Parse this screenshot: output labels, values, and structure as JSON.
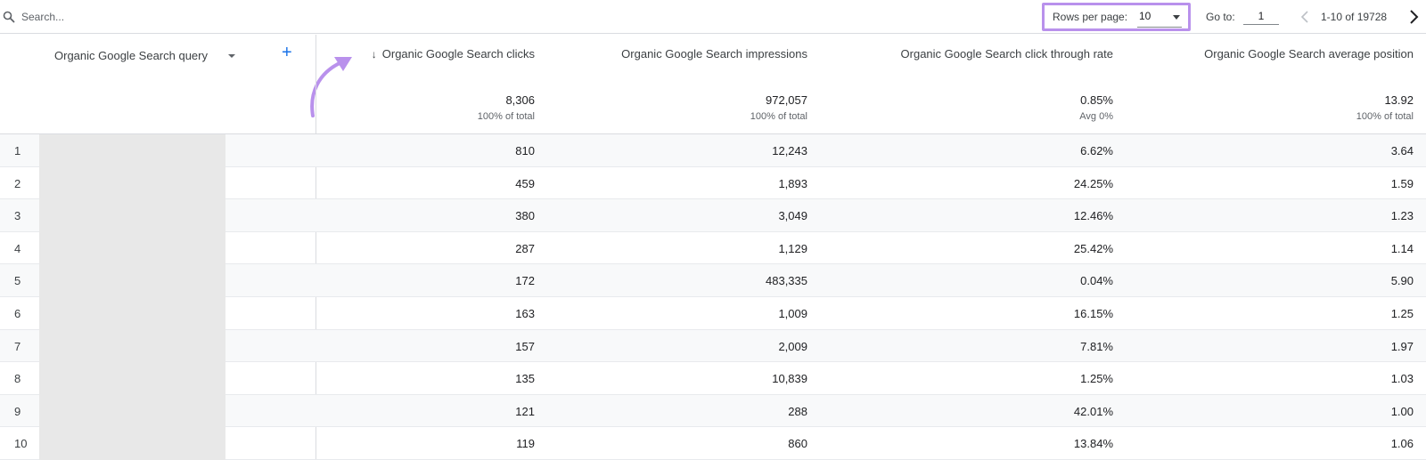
{
  "toolbar": {
    "search_placeholder": "Search...",
    "rows_per_page_label": "Rows per page:",
    "rows_per_page_value": "10",
    "goto_label": "Go to:",
    "goto_value": "1",
    "range_text": "1-10 of 19728"
  },
  "table": {
    "dimension_header": "Organic Google Search query",
    "columns": [
      {
        "label": "Organic Google Search clicks",
        "total": "8,306",
        "sub": "100% of total",
        "sorted": true
      },
      {
        "label": "Organic Google Search impressions",
        "total": "972,057",
        "sub": "100% of total"
      },
      {
        "label": "Organic Google Search click through rate",
        "total": "0.85%",
        "sub": "Avg 0%"
      },
      {
        "label": "Organic Google Search average position",
        "total": "13.92",
        "sub": "100% of total"
      }
    ],
    "rows": [
      {
        "index": "1",
        "clicks": "810",
        "impressions": "12,243",
        "ctr": "6.62%",
        "position": "3.64"
      },
      {
        "index": "2",
        "clicks": "459",
        "impressions": "1,893",
        "ctr": "24.25%",
        "position": "1.59"
      },
      {
        "index": "3",
        "clicks": "380",
        "impressions": "3,049",
        "ctr": "12.46%",
        "position": "1.23"
      },
      {
        "index": "4",
        "clicks": "287",
        "impressions": "1,129",
        "ctr": "25.42%",
        "position": "1.14"
      },
      {
        "index": "5",
        "clicks": "172",
        "impressions": "483,335",
        "ctr": "0.04%",
        "position": "5.90"
      },
      {
        "index": "6",
        "clicks": "163",
        "impressions": "1,009",
        "ctr": "16.15%",
        "position": "1.25"
      },
      {
        "index": "7",
        "clicks": "157",
        "impressions": "2,009",
        "ctr": "7.81%",
        "position": "1.97"
      },
      {
        "index": "8",
        "clicks": "135",
        "impressions": "10,839",
        "ctr": "1.25%",
        "position": "1.03"
      },
      {
        "index": "9",
        "clicks": "121",
        "impressions": "288",
        "ctr": "42.01%",
        "position": "1.00"
      },
      {
        "index": "10",
        "clicks": "119",
        "impressions": "860",
        "ctr": "13.84%",
        "position": "1.06"
      }
    ]
  },
  "colors": {
    "highlight": "#b991ec",
    "accent": "#1a73e8",
    "row_alt": "#f8f9fa"
  }
}
